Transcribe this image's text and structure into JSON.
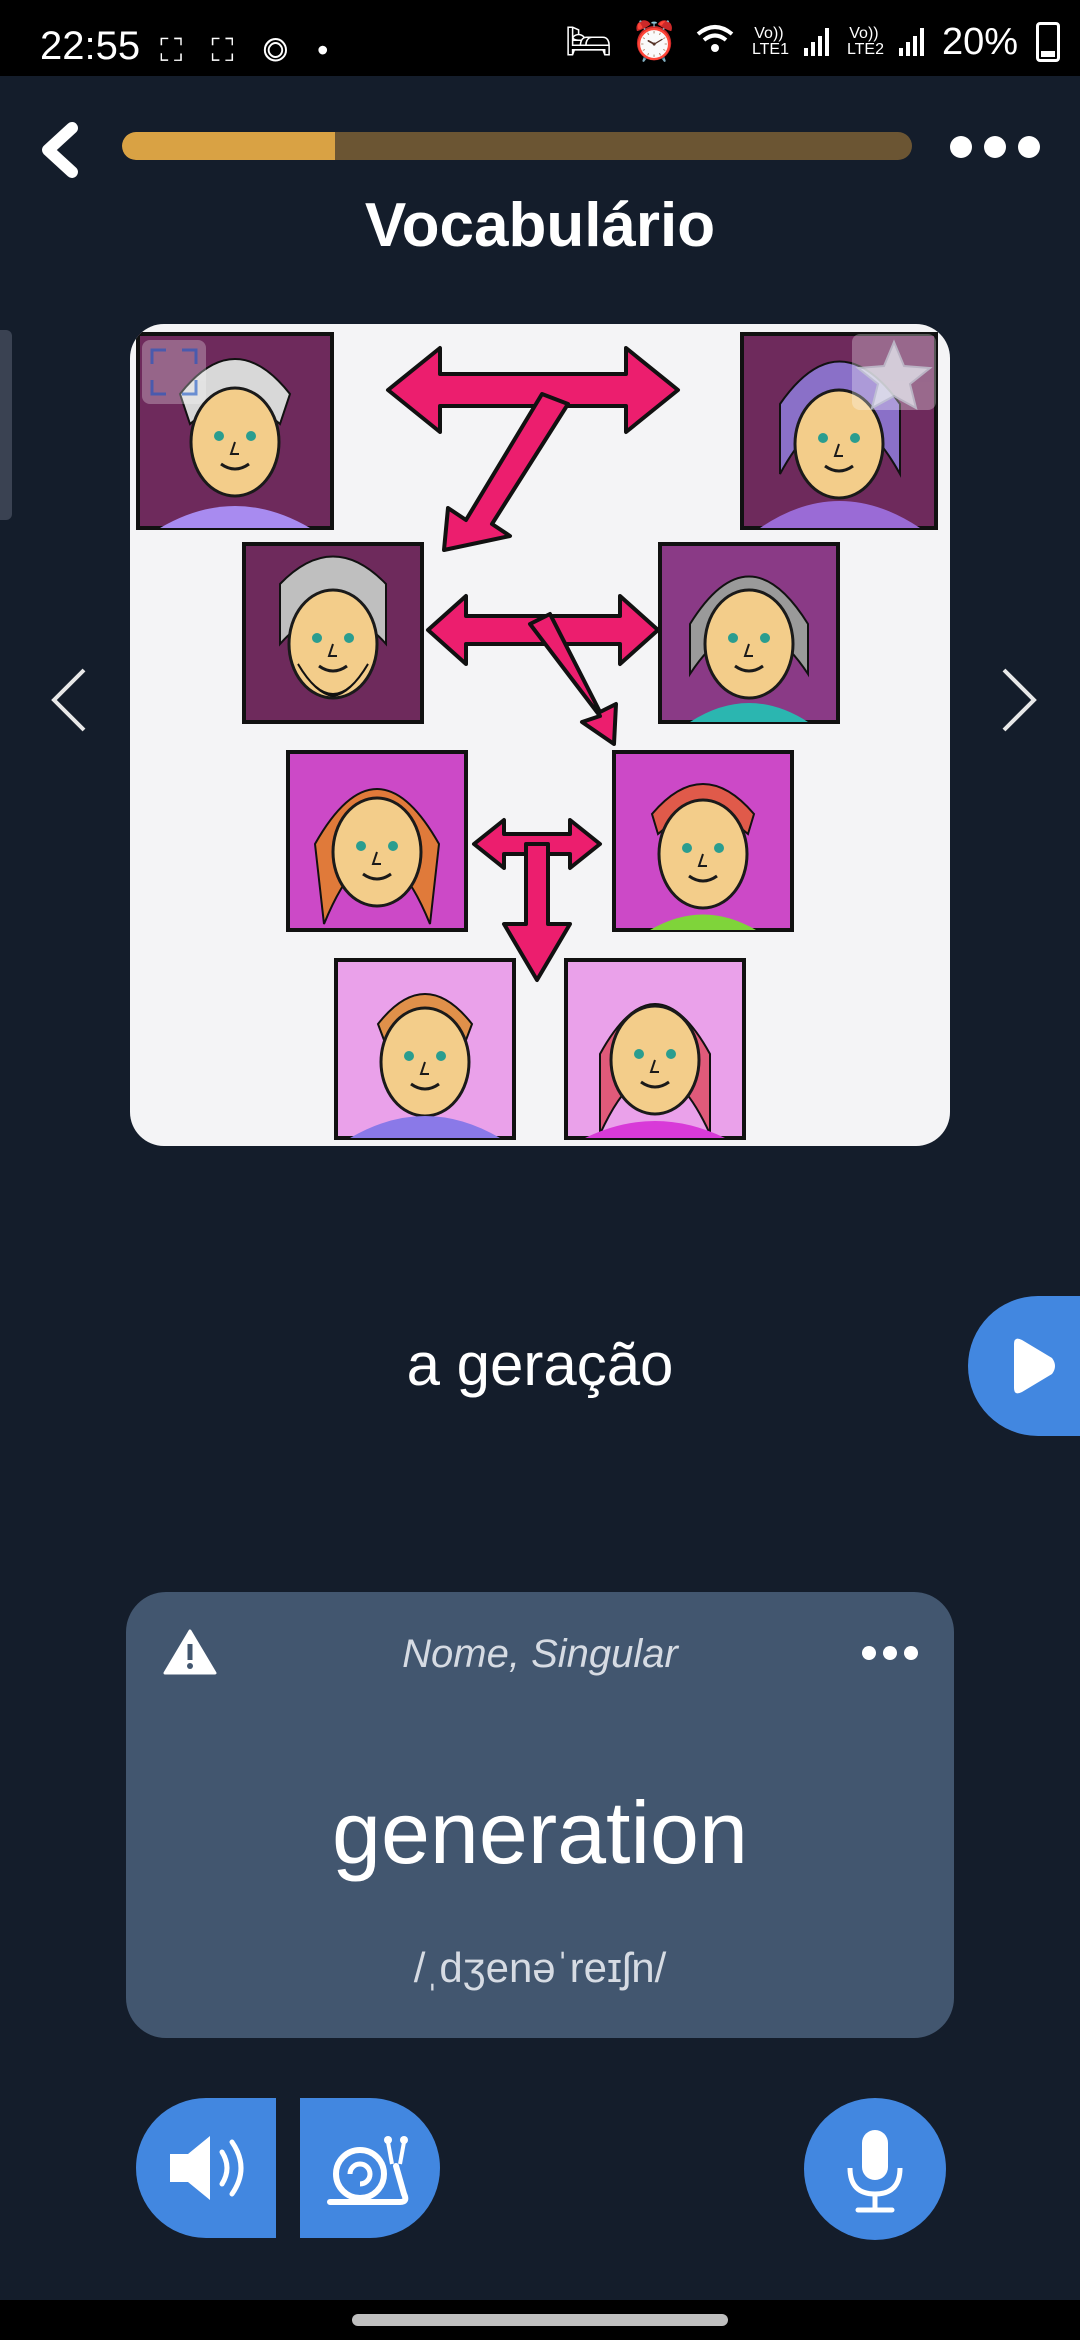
{
  "status_bar": {
    "time": "22:55",
    "battery": "20%",
    "sim1": "Vo)) LTE1",
    "sim2": "Vo)) LTE2",
    "icons": [
      "screenshot-icon",
      "screen-record-icon",
      "edge-icon",
      "dot-icon",
      "sleep-icon",
      "alarm-icon",
      "wifi-icon",
      "signal-icon",
      "battery-icon"
    ]
  },
  "header": {
    "title": "Vocabulário",
    "progress": 0.27
  },
  "colors": {
    "background": "#141d2b",
    "accent_blue": "#4287e0",
    "progress_fill": "#d9a244",
    "progress_track": "#6b5533",
    "card": "#42566f",
    "arrow_pink": "#ec1e6e"
  },
  "flashcard": {
    "word": "a geração",
    "part_of_speech": "Nome, Singular",
    "translation": "generation",
    "phonetic": "/ˌdʒenəˈreɪʃn/"
  }
}
